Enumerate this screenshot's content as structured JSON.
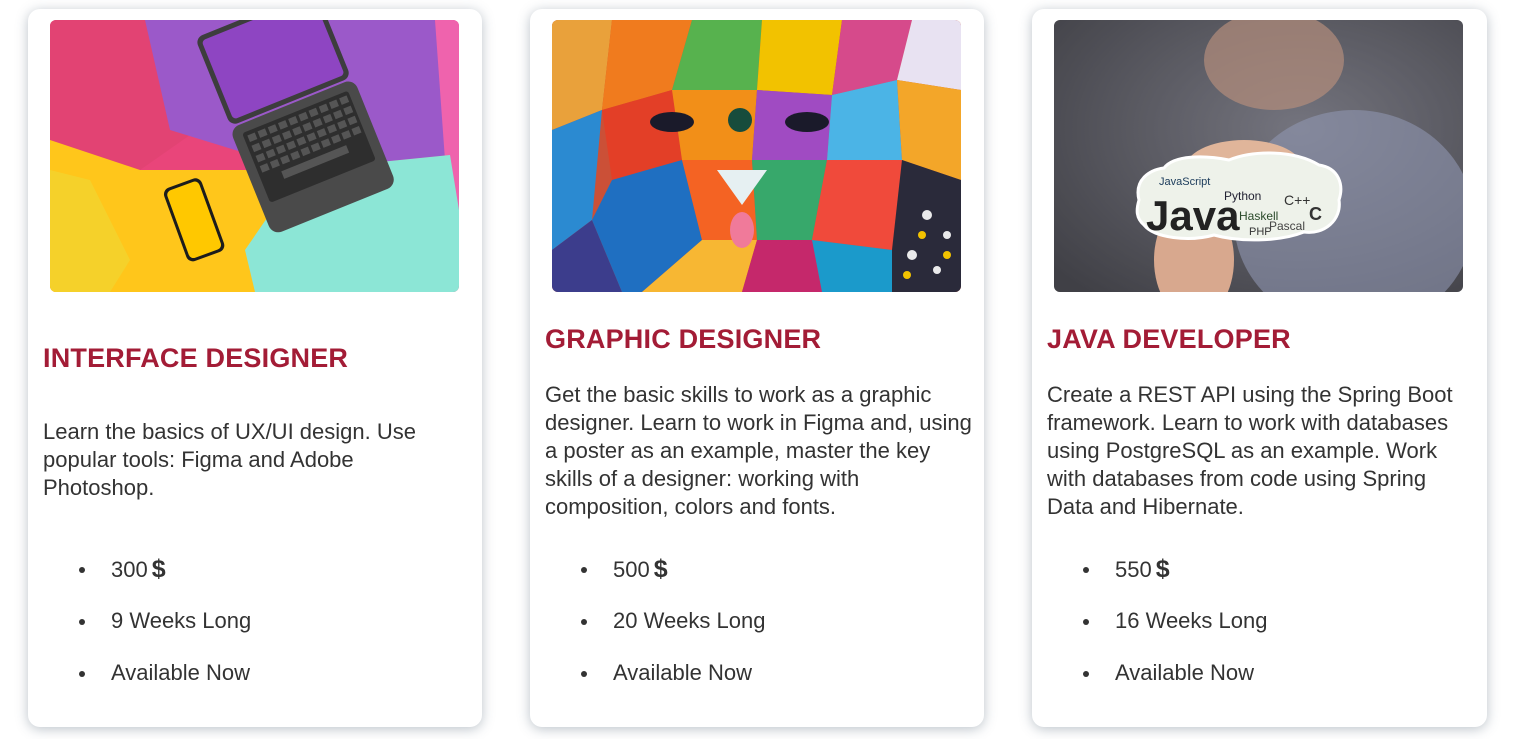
{
  "courses": [
    {
      "title": "INTERFACE DESIGNER",
      "description": "Learn the basics of UX/UI design. Use popular tools: Figma and Adobe Photoshop.",
      "price": "300",
      "currency": "$",
      "duration": "9 Weeks Long",
      "availability": "Available Now",
      "image": "laptop-and-phone-photo"
    },
    {
      "title": "GRAPHIC DESIGNER",
      "description": "Get the basic skills to work as a graphic designer. Learn to work in Figma and, using a poster as an example, master the key skills of a designer: working with composition, colors and fonts.",
      "price": "500",
      "currency": "$",
      "duration": "20 Weeks Long",
      "availability": "Available Now",
      "image": "geometric-bear-mural-photo"
    },
    {
      "title": "JAVA DEVELOPER",
      "description": "Create a REST API using the Spring Boot framework. Learn to work with databases using PostgreSQL as an example. Work with databases from code using Spring Data and Hibernate.",
      "price": "550",
      "currency": "$",
      "duration": "16 Weeks Long",
      "availability": "Available Now",
      "image": "java-sticker-photo"
    }
  ],
  "colors": {
    "title": "#a31c36",
    "text": "#333333",
    "card_background": "#ffffff"
  }
}
